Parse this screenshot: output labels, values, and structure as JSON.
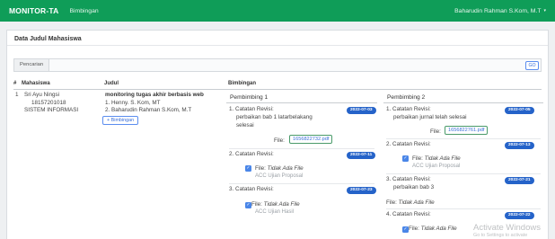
{
  "navbar": {
    "brand": "MONITOR-TA",
    "link": "Bimbingan",
    "user": "Baharudin Rahman S.Kom, M.T",
    "caret": "▾"
  },
  "card": {
    "title": "Data Judul Mahasiswa",
    "search_tab": "Pencarian",
    "go_label": "GO"
  },
  "table": {
    "headers": {
      "no": "#",
      "mahasiswa": "Mahasiswa",
      "judul": "Judul",
      "bimbingan": "Bimbingan"
    },
    "row": {
      "no": "1",
      "nama": "Sri Ayu Ningsi",
      "nim": "18157201018",
      "prodi": "SISTEM INFORMASI",
      "judul": "monitoring tugas akhir berbasis web",
      "pembimbing_1": "1. Henny. S. Kom, MT",
      "pembimbing_2": "2. Baharudin Rahman S.Kom, M.T",
      "bimbingan_button": "+ Bimbingan"
    }
  },
  "bimbingan": {
    "pembimbing_1": {
      "title": "Pembimbing 1",
      "revisions": [
        {
          "no": "1.",
          "label": "Catatan Revisi:",
          "date": "2022-07-03",
          "text_line1": "perbaikan bab 1 latarbelakang",
          "text_line2": "selesai",
          "file_label": "File:",
          "file_name": "1656822732.pdf"
        },
        {
          "no": "2.",
          "label": "Catatan Revisi:",
          "date": "2022-07-11",
          "file_label": "File:",
          "file_none": "Tidak Ada File",
          "status": "ACC Ujian Proposal"
        },
        {
          "no": "3.",
          "label": "Catatan Revisi:",
          "date": "2022-07-23",
          "file_label": "File:",
          "file_none": "Tidak Ada File",
          "status": "ACC Ujian Hasil"
        }
      ]
    },
    "pembimbing_2": {
      "title": "Pembimbing 2",
      "revisions": [
        {
          "no": "1.",
          "label": "Catatan Revisi:",
          "date": "2022-07-05",
          "text_line1": "perbaikan jurnal telah selesai",
          "file_label": "File:",
          "file_name": "1656822761.pdf"
        },
        {
          "no": "2.",
          "label": "Catatan Revisi:",
          "date": "2022-07-13",
          "file_label": "File:",
          "file_none": "Tidak Ada File",
          "status": "ACC Ujian Proposal"
        },
        {
          "no": "3.",
          "label": "Catatan Revisi:",
          "date": "2022-07-21",
          "text_line1": "perbaikan bab 3",
          "file_label": "File:",
          "file_none": "Tidak Ada File"
        },
        {
          "no": "4.",
          "label": "Catatan Revisi:",
          "date": "2022-07-22",
          "file_label": "File:",
          "file_none": "Tidak Ada File"
        }
      ]
    }
  },
  "watermark": {
    "title": "Activate Windows",
    "subtitle": "Go to Settings to activate"
  },
  "icons": {
    "check": "check-icon"
  },
  "colors": {
    "navbar": "#0f9d58",
    "badge": "#2563c9",
    "link": "#3b6fd8",
    "check": "#4a86e8"
  }
}
